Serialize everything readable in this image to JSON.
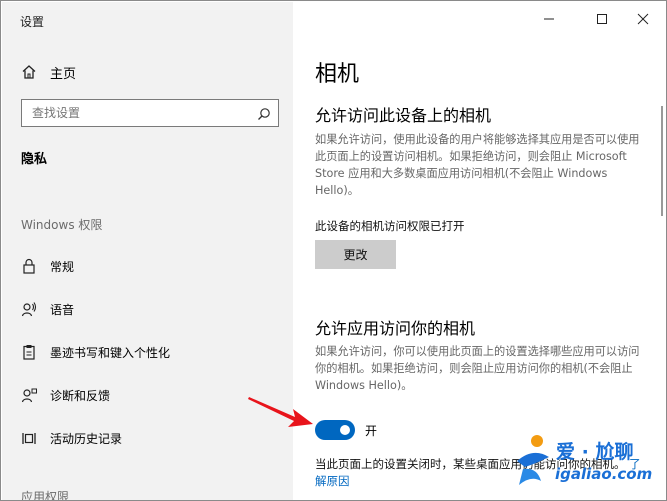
{
  "window": {
    "title": "设置"
  },
  "sidebar": {
    "home_label": "主页",
    "search_placeholder": "查找设置",
    "section_privacy": "隐私",
    "section_windows_permissions": "Windows 权限",
    "items": [
      {
        "label": "常规",
        "icon": "lock-icon"
      },
      {
        "label": "语音",
        "icon": "speech-icon"
      },
      {
        "label": "墨迹书写和键入个性化",
        "icon": "clipboard-icon"
      },
      {
        "label": "诊断和反馈",
        "icon": "feedback-icon"
      },
      {
        "label": "活动历史记录",
        "icon": "history-icon"
      }
    ],
    "section_app_permissions": "应用权限"
  },
  "main": {
    "title": "相机",
    "device_heading": "允许访问此设备上的相机",
    "device_desc": "如果允许访问，使用此设备的用户将能够选择其应用是否可以使用此页面上的设置访问相机。如果拒绝访问，则会阻止 Microsoft Store 应用和大多数桌面应用访问相机(不会阻止 Windows Hello)。",
    "device_status": "此设备的相机访问权限已打开",
    "change_button": "更改",
    "app_heading": "允许应用访问你的相机",
    "app_desc": "如果允许访问，你可以使用此页面上的设置选择哪些应用可以访问你的相机。如果拒绝访问，则会阻止应用访问你的相机(不会阻止 Windows Hello)。",
    "toggle_state": "开",
    "note_text": "当此页面上的设置关闭时，某些桌面应用仍能访问你的相机。",
    "note_link": "了解原因"
  },
  "watermark": {
    "text": "爱 · 尬聊",
    "sub": "igaliao.com"
  },
  "colors": {
    "accent": "#0067c0",
    "sidebar_bg": "#f2f2f2",
    "arrow": "#e8141b"
  }
}
